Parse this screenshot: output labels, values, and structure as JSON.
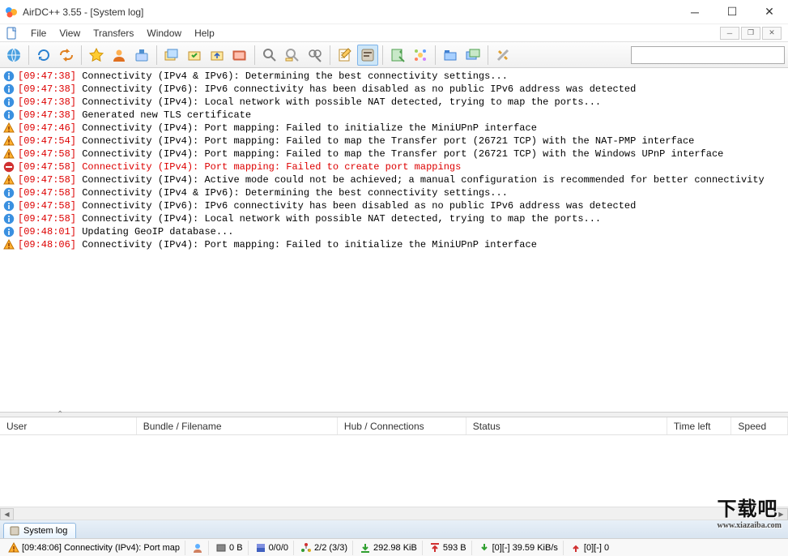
{
  "window": {
    "title": "AirDC++ 3.55 - [System log]"
  },
  "menu": {
    "items": [
      "File",
      "View",
      "Transfers",
      "Window",
      "Help"
    ]
  },
  "log": {
    "entries": [
      {
        "icon": "info",
        "ts": "[09:47:38]",
        "msg": "Connectivity (IPv4 & IPv6): Determining the best connectivity settings...",
        "err": false
      },
      {
        "icon": "info",
        "ts": "[09:47:38]",
        "msg": "Connectivity (IPv6): IPv6 connectivity has been disabled as no public IPv6 address was detected",
        "err": false
      },
      {
        "icon": "info",
        "ts": "[09:47:38]",
        "msg": "Connectivity (IPv4): Local network with possible NAT detected, trying to map the ports...",
        "err": false
      },
      {
        "icon": "info",
        "ts": "[09:47:38]",
        "msg": "Generated new TLS certificate",
        "err": false
      },
      {
        "icon": "warn",
        "ts": "[09:47:46]",
        "msg": "Connectivity (IPv4): Port mapping: Failed to initialize the MiniUPnP interface",
        "err": false
      },
      {
        "icon": "warn",
        "ts": "[09:47:54]",
        "msg": "Connectivity (IPv4): Port mapping: Failed to map the Transfer port (26721 TCP) with the NAT-PMP interface",
        "err": false
      },
      {
        "icon": "warn",
        "ts": "[09:47:58]",
        "msg": "Connectivity (IPv4): Port mapping: Failed to map the Transfer port (26721 TCP) with the Windows UPnP interface",
        "err": false
      },
      {
        "icon": "error",
        "ts": "[09:47:58]",
        "msg": "Connectivity (IPv4): Port mapping: Failed to create port mappings",
        "err": true
      },
      {
        "icon": "warn",
        "ts": "[09:47:58]",
        "msg": "Connectivity (IPv4): Active mode could not be achieved; a manual configuration is recommended for better connectivity",
        "err": false
      },
      {
        "icon": "info",
        "ts": "[09:47:58]",
        "msg": "Connectivity (IPv4 & IPv6): Determining the best connectivity settings...",
        "err": false
      },
      {
        "icon": "info",
        "ts": "[09:47:58]",
        "msg": "Connectivity (IPv6): IPv6 connectivity has been disabled as no public IPv6 address was detected",
        "err": false
      },
      {
        "icon": "info",
        "ts": "[09:47:58]",
        "msg": "Connectivity (IPv4): Local network with possible NAT detected, trying to map the ports...",
        "err": false
      },
      {
        "icon": "info",
        "ts": "[09:48:01]",
        "msg": "Updating GeoIP database...",
        "err": false
      },
      {
        "icon": "warn",
        "ts": "[09:48:06]",
        "msg": "Connectivity (IPv4): Port mapping: Failed to initialize the MiniUPnP interface",
        "err": false
      }
    ]
  },
  "transfers": {
    "columns": [
      "User",
      "Bundle / Filename",
      "Hub / Connections",
      "Status",
      "Time left",
      "Speed"
    ]
  },
  "tabs": {
    "active": "System log"
  },
  "status": {
    "last_msg": "[09:48:06] Connectivity (IPv4): Port map",
    "share": "0 B",
    "slots": "0/0/0",
    "hubs": "2/2 (3/3)",
    "down_total": "292.98 KiB",
    "up_total": "593 B",
    "down_speed": "[0][-] 39.59 KiB/s",
    "up_speed": "[0][-] 0"
  },
  "watermark": {
    "text": "下载吧",
    "url": "www.xiazaiba.com"
  }
}
